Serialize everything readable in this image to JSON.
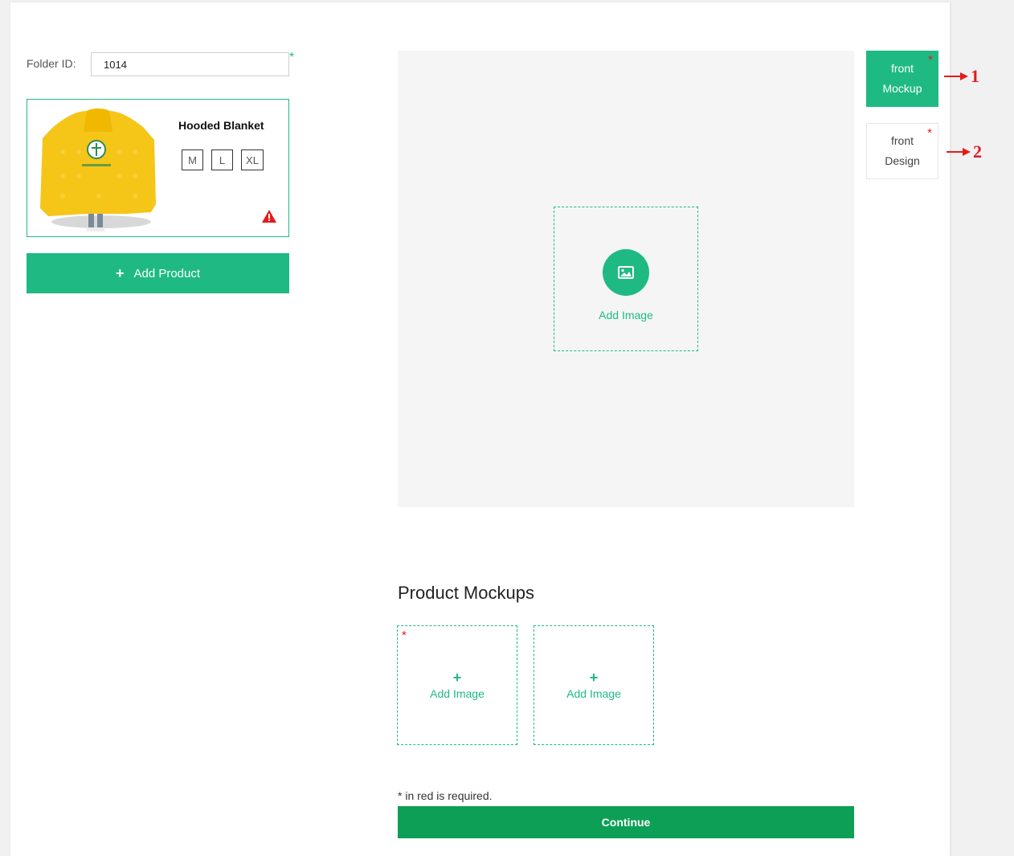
{
  "form": {
    "folder_label": "Folder ID:",
    "folder_value": "1014",
    "required_mark": "*"
  },
  "product": {
    "title": "Hooded Blanket",
    "sizes": [
      "M",
      "L",
      "XL"
    ],
    "image_icon": "hooded-blanket-photo",
    "warning_icon": "warning-triangle-icon"
  },
  "add_product_label": "Add Product",
  "preview": {
    "add_image_label": "Add Image",
    "icon": "image-icon"
  },
  "tabs": [
    {
      "line1": "front",
      "line2": "Mockup",
      "active": true,
      "callout": "1"
    },
    {
      "line1": "front",
      "line2": "Design",
      "active": false,
      "callout": "2"
    }
  ],
  "mockups": {
    "title": "Product Mockups",
    "slots": [
      {
        "label": "Add Image",
        "required": true
      },
      {
        "label": "Add Image",
        "required": false
      }
    ]
  },
  "required_note": "* in red is required.",
  "continue_label": "Continue",
  "colors": {
    "accent": "#1fba84",
    "continue": "#0d9f56",
    "required": "#e31b1b"
  }
}
